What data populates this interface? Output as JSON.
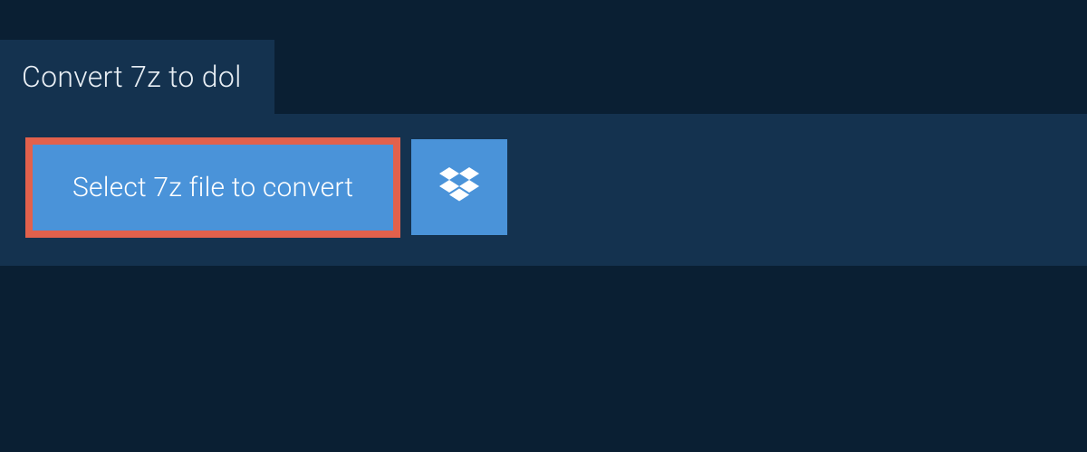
{
  "header": {
    "title": "Convert 7z to dol"
  },
  "actions": {
    "select_file_label": "Select 7z file to convert"
  },
  "colors": {
    "background": "#0a1f33",
    "panel": "#14324f",
    "button": "#4a93d9",
    "highlight_border": "#e2614c",
    "text_light": "#e8eef4",
    "text_white": "#ffffff"
  }
}
